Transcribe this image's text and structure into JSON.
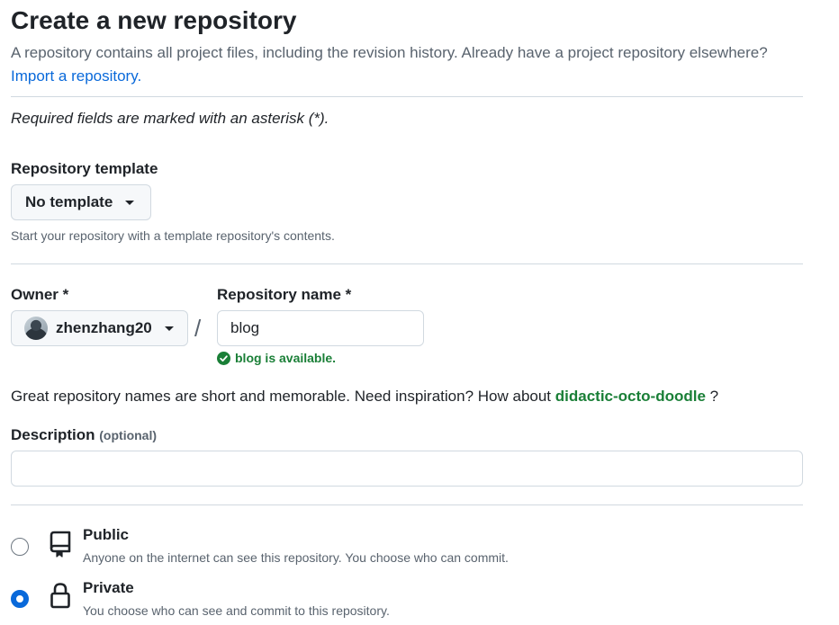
{
  "header": {
    "title": "Create a new repository",
    "intro": "A repository contains all project files, including the revision history. Already have a project repository elsewhere?",
    "import_link": "Import a repository."
  },
  "required_note": "Required fields are marked with an asterisk (*).",
  "template": {
    "label": "Repository template",
    "selected": "No template",
    "hint": "Start your repository with a template repository's contents."
  },
  "owner": {
    "label": "Owner *",
    "value": "zhenzhang20"
  },
  "separator": "/",
  "repo_name": {
    "label": "Repository name *",
    "value": "blog",
    "availability": "blog is available."
  },
  "suggestion": {
    "text": "Great repository names are short and memorable. Need inspiration? How about",
    "name": "didactic-octo-doodle",
    "suffix": "?"
  },
  "description": {
    "label": "Description",
    "optional": "(optional)",
    "value": ""
  },
  "visibility": {
    "options": [
      {
        "title": "Public",
        "description": "Anyone on the internet can see this repository. You choose who can commit.",
        "icon": "repo-icon",
        "selected": false
      },
      {
        "title": "Private",
        "description": "You choose who can see and commit to this repository.",
        "icon": "lock-icon",
        "selected": true
      }
    ]
  },
  "colors": {
    "link": "#0969da",
    "success": "#1a7f37",
    "muted": "#59636e",
    "border": "#d1d9e0"
  }
}
